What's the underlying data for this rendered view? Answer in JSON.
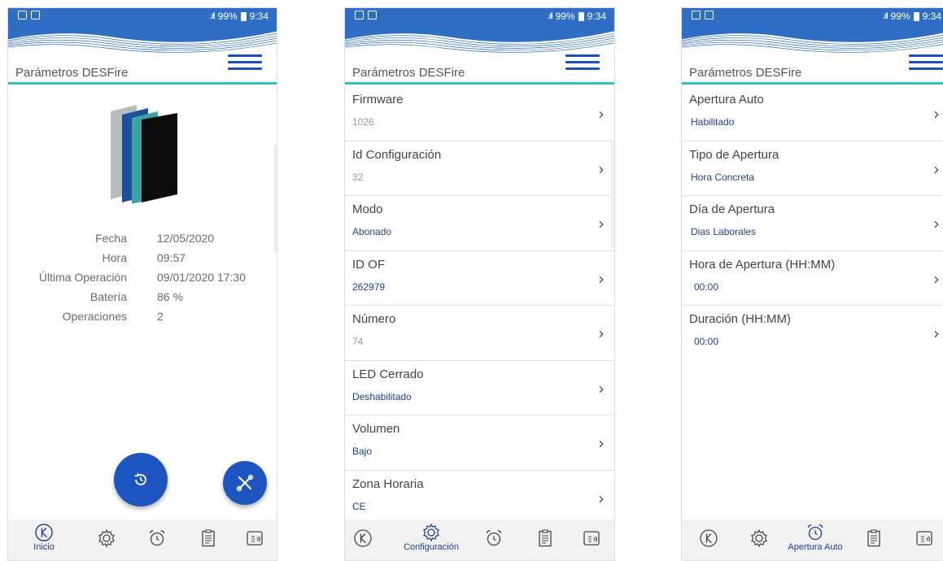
{
  "status_bar": {
    "signal": ".ıll",
    "battery": "99%",
    "time": "9:34"
  },
  "app_title": "Parámetros DESFire",
  "screen_home": {
    "info": [
      {
        "label": "Fecha",
        "value": "12/05/2020"
      },
      {
        "label": "Hora",
        "value": "09:57"
      },
      {
        "label": "Última Operación",
        "value": "09/01/2020 17:30"
      },
      {
        "label": "Batería",
        "value": "86 %"
      },
      {
        "label": "Operaciones",
        "value": "2"
      }
    ]
  },
  "screen_config": {
    "items": [
      {
        "label": "Firmware",
        "value": "1026"
      },
      {
        "label": "Id Configuración",
        "value": "32"
      },
      {
        "label": "Modo",
        "value": "Abonado"
      },
      {
        "label": "ID OF",
        "value": "262979"
      },
      {
        "label": "Número",
        "value": "74"
      },
      {
        "label": "LED Cerrado",
        "value": "Deshabilitado"
      },
      {
        "label": "Volumen",
        "value": "Bajo"
      },
      {
        "label": "Zona Horaria",
        "value": "CE"
      }
    ]
  },
  "screen_auto_open": {
    "items": [
      {
        "label": "Apertura Auto",
        "value": "Habilitado"
      },
      {
        "label": "Tipo de Apertura",
        "value": "Hora Concreta"
      },
      {
        "label": "Día de Apertura",
        "value": "Dias Laborales"
      },
      {
        "label": "Hora de Apertura (HH:MM)",
        "value": "00:00"
      },
      {
        "label": "Duración (HH:MM)",
        "value": "00:00"
      }
    ]
  },
  "bottom_nav": {
    "home_label": "Inicio",
    "config_label": "Configuración",
    "auto_open_label": "Apertura Auto"
  },
  "colors": {
    "status_bar": "#2f6ec5",
    "accent": "#1e55c0",
    "underline": "#2fc1c9",
    "value_blue": "#1f3f9c"
  }
}
